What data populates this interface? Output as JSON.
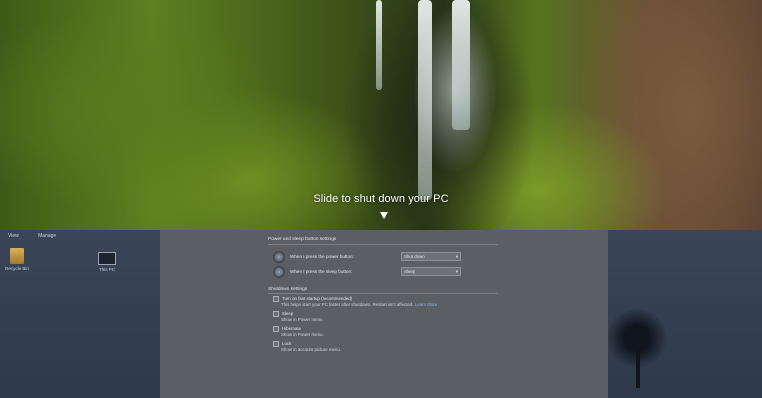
{
  "lock": {
    "prompt": "Slide to shut down your PC",
    "arrow_icon": "arrow-down-icon"
  },
  "desktop": {
    "explorer_tabs": [
      "View",
      "Manage"
    ],
    "icons": [
      {
        "label": "Recycle Bin",
        "icon": "folder-icon"
      },
      {
        "label": "This PC",
        "icon": "computer-icon"
      }
    ]
  },
  "settings": {
    "power_section_title": "Power and sleep button settings",
    "power_button_label": "When I press the power button:",
    "power_button_value": "Shut down",
    "sleep_button_label": "When I press the sleep button:",
    "sleep_button_value": "Sleep",
    "shutdown_section_title": "Shutdown settings",
    "options": [
      {
        "label": "Turn on fast startup (recommended)",
        "desc": "This helps start your PC faster after shutdown. Restart isn't affected.",
        "link": "Learn More"
      },
      {
        "label": "Sleep",
        "desc": "Show in Power menu."
      },
      {
        "label": "Hibernate",
        "desc": "Show in Power menu."
      },
      {
        "label": "Lock",
        "desc": "Show in account picture menu."
      }
    ]
  },
  "colors": {
    "overlay_text": "#ffffff",
    "settings_bg": "#5b5e63",
    "link": "#8fb4e0"
  }
}
